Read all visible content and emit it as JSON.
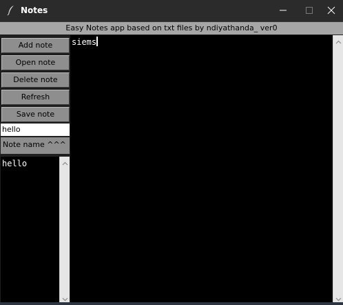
{
  "window": {
    "title": "Notes",
    "icon": "feather-icon"
  },
  "header": {
    "text": "Easy Notes app based on txt files by ndiyathanda_ ver0"
  },
  "sidebar": {
    "buttons": {
      "add": "Add note",
      "open": "Open note",
      "delete": "Delete note",
      "refresh": "Refresh",
      "save": "Save note"
    },
    "note_name_input": {
      "value": "hello"
    },
    "note_name_label": "Note name ^^^",
    "notes_list": [
      "hello"
    ]
  },
  "editor": {
    "content": "siems"
  },
  "colors": {
    "titlebar": "#2b2b2b",
    "header": "#a6a6a6",
    "button": "#8e8e8e",
    "editor_bg": "#000000",
    "editor_text": "#ffffff"
  }
}
